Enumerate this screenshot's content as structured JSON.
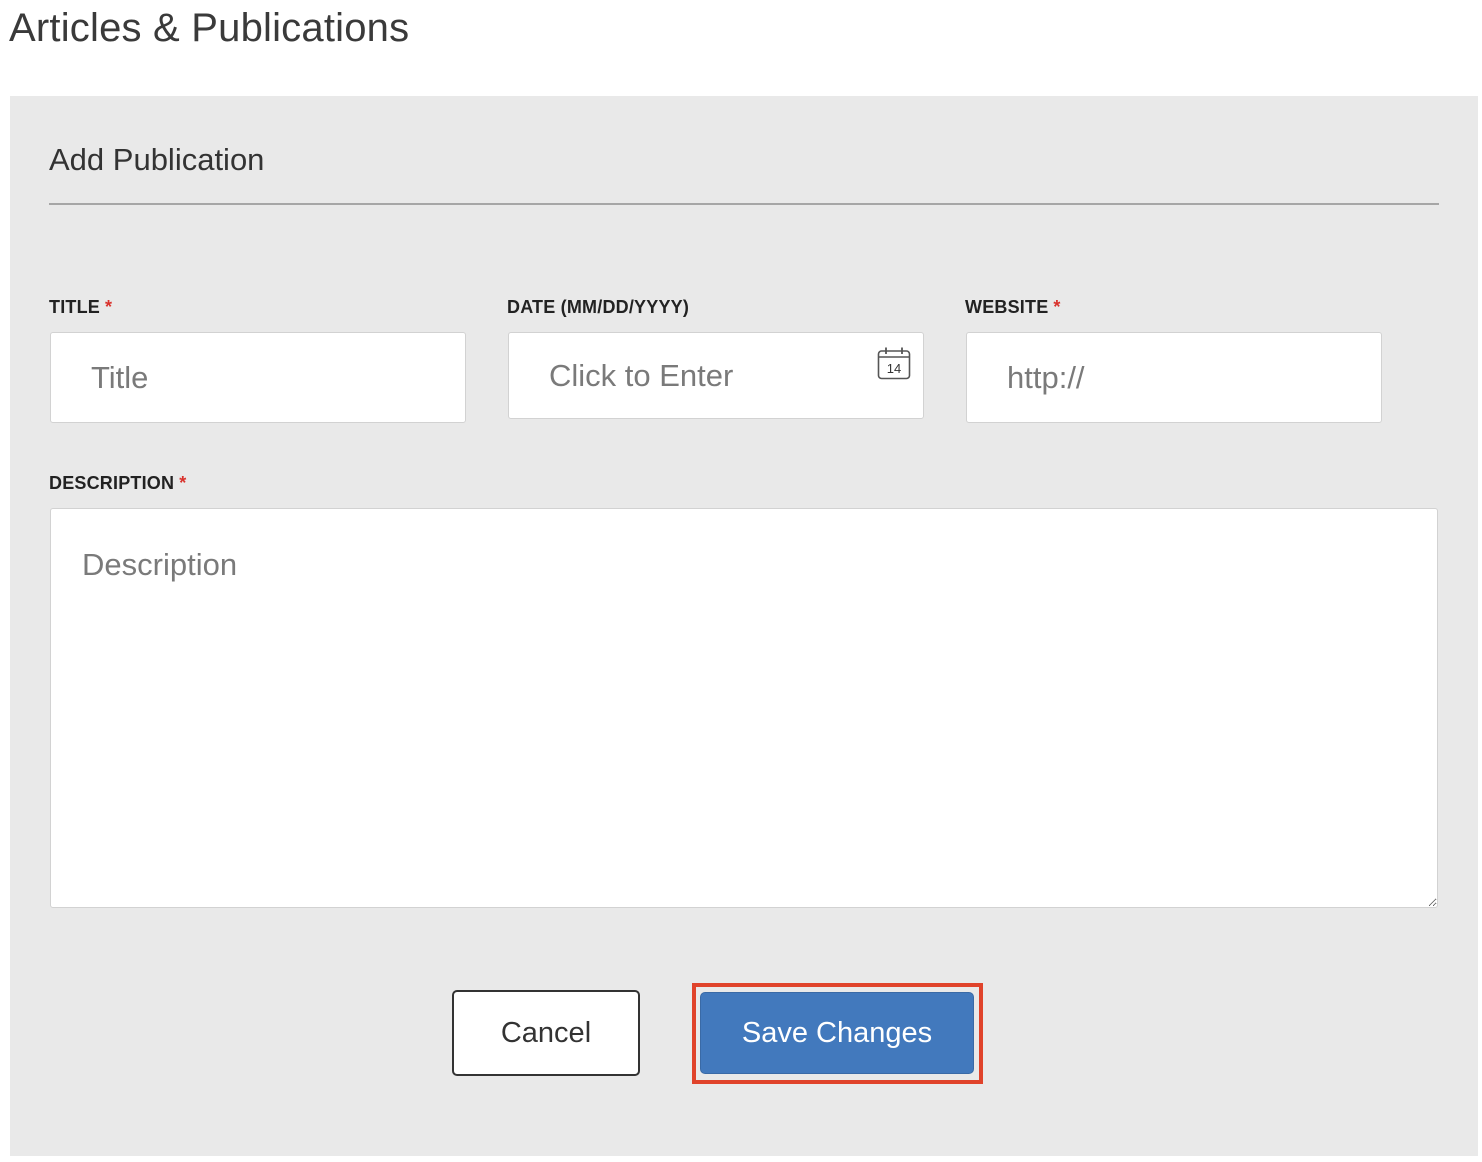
{
  "page": {
    "title": "Articles & Publications"
  },
  "form": {
    "heading": "Add Publication",
    "required_marker": "*",
    "fields": {
      "title": {
        "label": "TITLE",
        "required": true,
        "placeholder": "Title",
        "value": ""
      },
      "date": {
        "label": "DATE (MM/DD/YYYY)",
        "required": false,
        "placeholder": "Click to Enter",
        "value": "",
        "calendar_icon": "calendar-icon",
        "calendar_day": "14"
      },
      "website": {
        "label": "WEBSITE",
        "required": true,
        "placeholder": "http://",
        "value": ""
      },
      "description": {
        "label": "DESCRIPTION",
        "required": true,
        "placeholder": "Description",
        "value": ""
      }
    },
    "buttons": {
      "cancel_label": "Cancel",
      "save_label": "Save Changes"
    }
  },
  "colors": {
    "panel_background": "#e9e9e9",
    "primary_button": "#4279bd",
    "required_asterisk": "#d9312b",
    "highlight_outline": "#e0432b"
  }
}
